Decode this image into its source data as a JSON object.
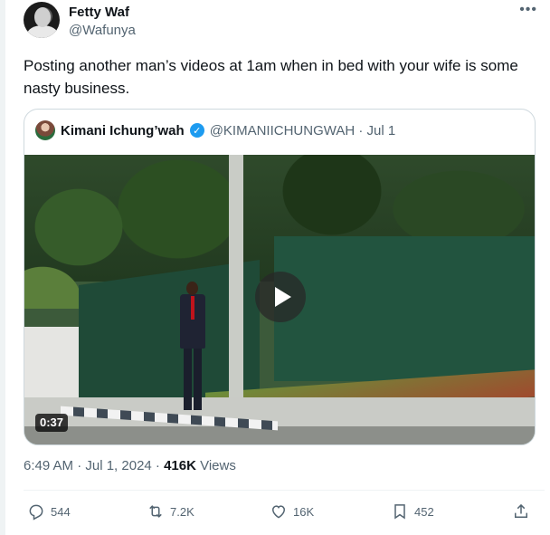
{
  "author": {
    "display_name": "Fetty Waf",
    "handle": "@Wafunya"
  },
  "more_icon": "more-horizontal-icon",
  "tweet_text": "Posting another man’s videos at 1am when in bed with your wife is some nasty business.",
  "quote": {
    "display_name": "Kimani Ichung’wah",
    "verified_icon": "verified-badge-icon",
    "handle_date": "@KIMANIICHUNGWAH · Jul 1",
    "video_duration": "0:37",
    "play_icon": "play-icon"
  },
  "meta": {
    "timestamp": "6:49 AM · Jul 1, 2024 · ",
    "views_count": "416K",
    "views_label": " Views"
  },
  "actions": {
    "replies": "544",
    "reposts": "7.2K",
    "likes": "16K",
    "bookmarks": "452"
  },
  "colors": {
    "text_primary": "#0f1419",
    "text_secondary": "#536471",
    "verified_blue": "#1d9bf0",
    "border": "#cfd9de"
  }
}
